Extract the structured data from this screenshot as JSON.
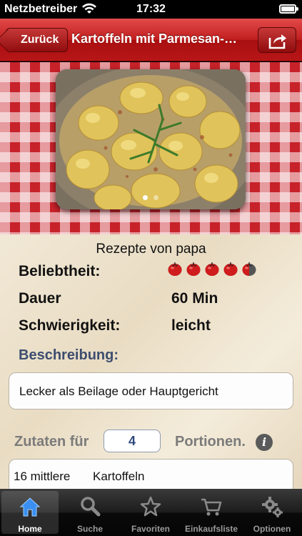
{
  "status_bar": {
    "carrier": "Netzbetreiber",
    "time": "17:32"
  },
  "navbar": {
    "back_label": "Zurück",
    "title": "Kartoffeln mit Parmesan-…"
  },
  "gallery": {
    "dot_count": 2,
    "active_index": 0
  },
  "recipe": {
    "author": "Rezepte von papa",
    "popularity_label": "Beliebtheit:",
    "popularity_rating": 4.5,
    "popularity_max": 5,
    "duration_label": "Dauer",
    "duration_value": "60 Min",
    "difficulty_label": "Schwierigkeit:",
    "difficulty_value": "leicht",
    "description_title": "Beschreibung:",
    "description": "Lecker als Beilage oder Hauptgericht",
    "ingredients_prefix": "Zutaten für",
    "portions": "4",
    "ingredients_suffix": "Portionen.",
    "ingredients": [
      {
        "quantity": "16 mittlere",
        "name": "Kartoffeln"
      }
    ]
  },
  "tabbar": {
    "tabs": [
      {
        "label": "Home",
        "icon": "home-icon",
        "active": true
      },
      {
        "label": "Suche",
        "icon": "search-icon",
        "active": false
      },
      {
        "label": "Favoriten",
        "icon": "star-icon",
        "active": false
      },
      {
        "label": "Einkaufsliste",
        "icon": "cart-icon",
        "active": false
      },
      {
        "label": "Optionen",
        "icon": "gear-icon",
        "active": false
      }
    ]
  },
  "colors": {
    "navbar_red": "#c11f1f",
    "section_blue": "#3c4d6f",
    "tomato_red": "#d01c1c"
  }
}
